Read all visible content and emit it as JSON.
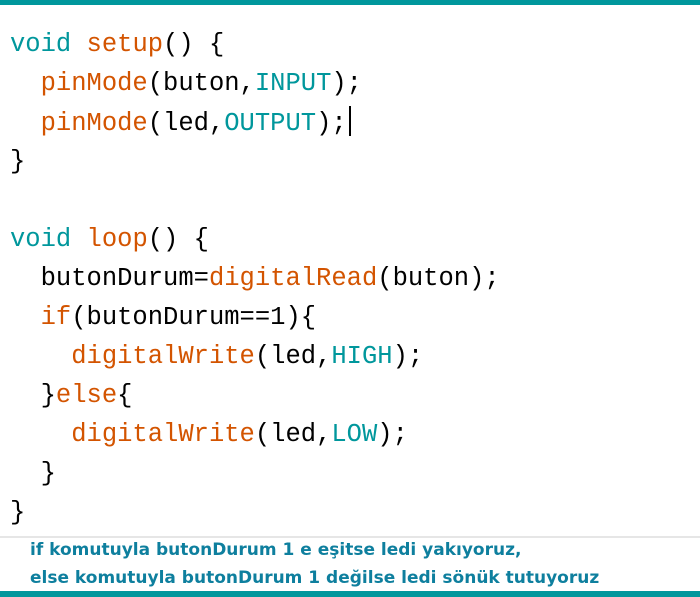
{
  "colors": {
    "frame": "#00979c",
    "keyword": "#00979c",
    "function": "#d35400",
    "plain": "#333333",
    "caption": "#0e7f9e"
  },
  "code": [
    [
      {
        "t": "void",
        "c": "kw"
      },
      {
        "t": " ",
        "c": "pl"
      },
      {
        "t": "setup",
        "c": "fn"
      },
      {
        "t": "() {",
        "c": "pl"
      }
    ],
    [
      {
        "t": "  ",
        "c": "pl"
      },
      {
        "t": "pinMode",
        "c": "fn"
      },
      {
        "t": "(buton,",
        "c": "pl"
      },
      {
        "t": "INPUT",
        "c": "kw"
      },
      {
        "t": ");",
        "c": "pl"
      }
    ],
    [
      {
        "t": "  ",
        "c": "pl"
      },
      {
        "t": "pinMode",
        "c": "fn"
      },
      {
        "t": "(led,",
        "c": "pl"
      },
      {
        "t": "OUTPUT",
        "c": "kw"
      },
      {
        "t": ");",
        "c": "pl"
      }
    ],
    [
      {
        "t": "}",
        "c": "pl"
      }
    ],
    [],
    [
      {
        "t": "void",
        "c": "kw"
      },
      {
        "t": " ",
        "c": "pl"
      },
      {
        "t": "loop",
        "c": "fn"
      },
      {
        "t": "() {",
        "c": "pl"
      }
    ],
    [
      {
        "t": "  butonDurum=",
        "c": "pl"
      },
      {
        "t": "digitalRead",
        "c": "fn"
      },
      {
        "t": "(buton);",
        "c": "pl"
      }
    ],
    [
      {
        "t": "  ",
        "c": "pl"
      },
      {
        "t": "if",
        "c": "fn"
      },
      {
        "t": "(butonDurum==1){",
        "c": "pl"
      }
    ],
    [
      {
        "t": "    ",
        "c": "pl"
      },
      {
        "t": "digitalWrite",
        "c": "fn"
      },
      {
        "t": "(led,",
        "c": "pl"
      },
      {
        "t": "HIGH",
        "c": "kw"
      },
      {
        "t": ");",
        "c": "pl"
      }
    ],
    [
      {
        "t": "  }",
        "c": "pl"
      },
      {
        "t": "else",
        "c": "fn"
      },
      {
        "t": "{",
        "c": "pl"
      }
    ],
    [
      {
        "t": "    ",
        "c": "pl"
      },
      {
        "t": "digitalWrite",
        "c": "fn"
      },
      {
        "t": "(led,",
        "c": "pl"
      },
      {
        "t": "LOW",
        "c": "kw"
      },
      {
        "t": ");",
        "c": "pl"
      }
    ],
    [
      {
        "t": "  }",
        "c": "pl"
      }
    ],
    [
      {
        "t": "}",
        "c": "pl"
      }
    ]
  ],
  "caption": {
    "line1": "if komutuyla butonDurum 1 e eşitse ledi yakıyoruz,",
    "line2": "else komutuyla butonDurum 1 değilse ledi sönük tutuyoruz"
  }
}
